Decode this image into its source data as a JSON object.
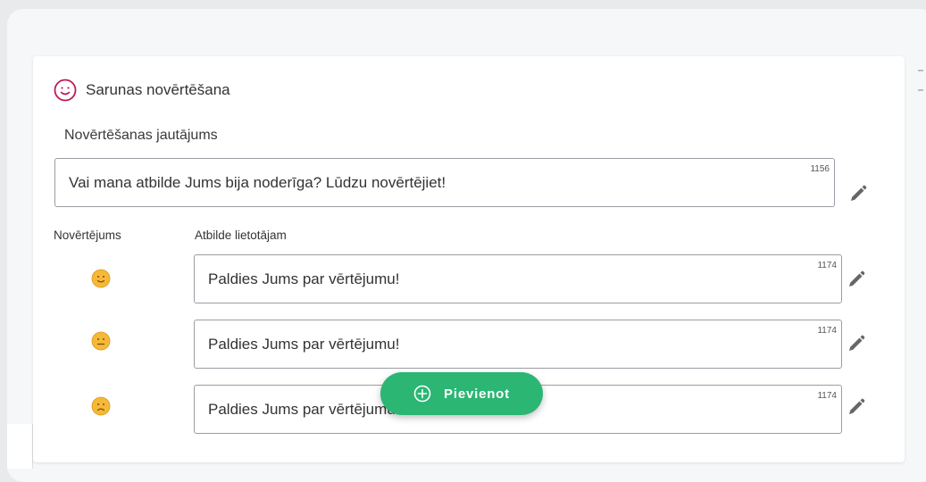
{
  "section": {
    "title": "Sarunas novērtēšana",
    "icon": "smile-icon"
  },
  "question": {
    "label": "Novērtēšanas jautājums",
    "value": "Vai mana atbilde Jums bija noderīga? Lūdzu novērtējiet!",
    "counter": "1156"
  },
  "columns": {
    "rating": "Novērtējums",
    "reply": "Atbilde lietotājam"
  },
  "ratings": [
    {
      "emoji": "smiling-face-icon",
      "reply": "Paldies Jums par vērtējumu!",
      "counter": "1174"
    },
    {
      "emoji": "neutral-face-icon",
      "reply": "Paldies Jums par vērtējumu!",
      "counter": "1174"
    },
    {
      "emoji": "frowning-face-icon",
      "reply": "Paldies Jums par vērtējumu!",
      "counter": "1174"
    }
  ],
  "add_button": {
    "label": "Pievienot",
    "icon": "plus-circle-icon",
    "color": "#2bb673"
  },
  "colors": {
    "accent_icon": "#c2185b",
    "emoji_fill": "#f5b937"
  }
}
